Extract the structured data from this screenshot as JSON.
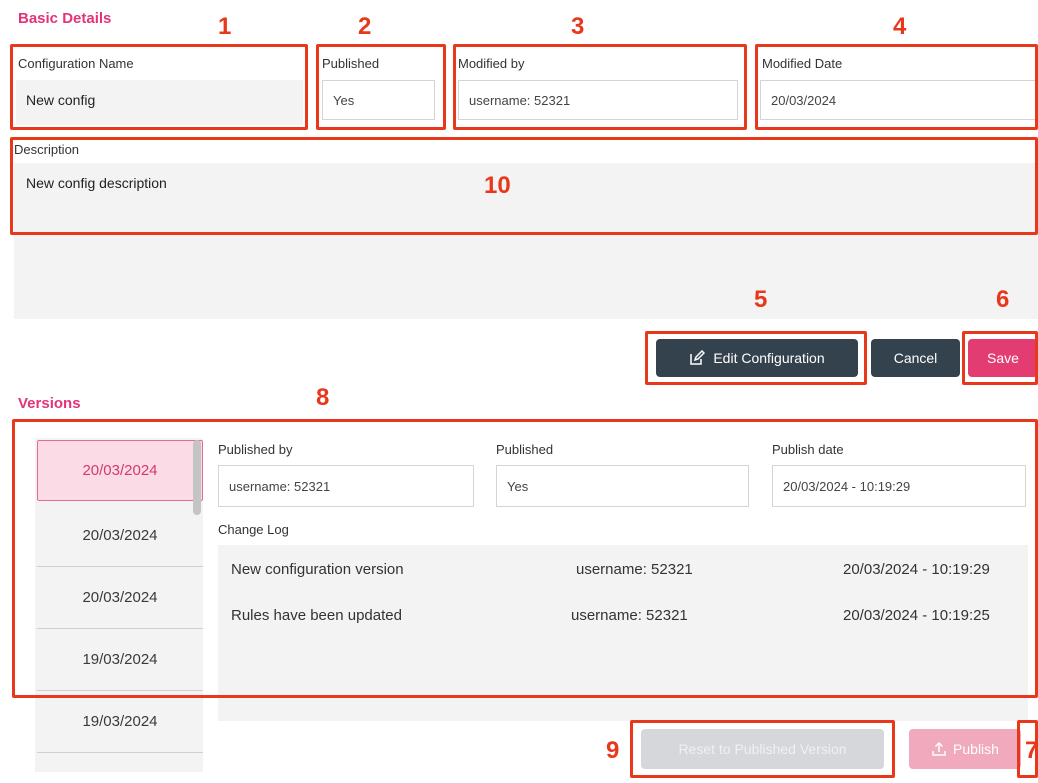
{
  "basic_details": {
    "title": "Basic Details",
    "config_name_label": "Configuration Name",
    "config_name_value": "New config",
    "published_label": "Published",
    "published_value": "Yes",
    "modified_by_label": "Modified by",
    "modified_by_value": "username: 52321",
    "modified_date_label": "Modified Date",
    "modified_date_value": "20/03/2024",
    "description_label": "Description",
    "description_value": "New config description"
  },
  "actions": {
    "edit_label": "Edit Configuration",
    "cancel_label": "Cancel",
    "save_label": "Save"
  },
  "versions": {
    "title": "Versions",
    "list": [
      "20/03/2024",
      "20/03/2024",
      "20/03/2024",
      "19/03/2024",
      "19/03/2024"
    ],
    "published_by_label": "Published by",
    "published_by_value": "username: 52321",
    "published_label": "Published",
    "published_value": "Yes",
    "publish_date_label": "Publish date",
    "publish_date_value": "20/03/2024 - 10:19:29",
    "change_log_label": "Change Log",
    "change_log": [
      {
        "description": "New configuration version",
        "user": "username: 52321",
        "date": "20/03/2024 - 10:19:29"
      },
      {
        "description": "Rules have been updated",
        "user": "username: 52321",
        "date": "20/03/2024 - 10:19:25"
      }
    ],
    "reset_label": "Reset to Published Version",
    "publish_label": "Publish"
  },
  "annotations": [
    "1",
    "2",
    "3",
    "4",
    "5",
    "6",
    "7",
    "8",
    "9",
    "10"
  ],
  "colors": {
    "accent": "#e3337a",
    "annotation": "#e8381c",
    "dark_button": "#34424e",
    "active_version_bg": "#fbdbe6"
  },
  "icons": {
    "edit": "edit-icon",
    "publish": "upload-icon"
  }
}
